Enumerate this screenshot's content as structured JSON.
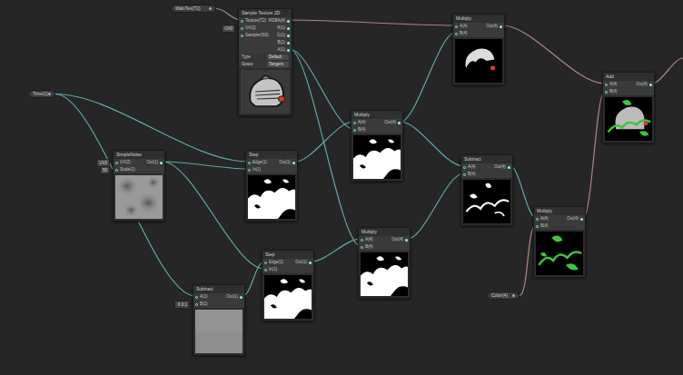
{
  "graph": {
    "nodes": [
      {
        "title": "MainTex(T2)",
        "kind": "property",
        "inputs": [],
        "outputs": [],
        "settings": []
      },
      {
        "title": "Sample Texture 2D",
        "kind": "texture",
        "inputs": [
          {
            "label": "Texture(T2)",
            "value": ""
          },
          {
            "label": "UV(2)",
            "value": "UV0"
          },
          {
            "label": "Sampler(SS)",
            "value": ""
          }
        ],
        "outputs": [
          "RGBA(4)",
          "R(1)",
          "G(1)",
          "B(1)",
          "A(1)"
        ],
        "settings": [
          {
            "label": "Type",
            "value": "Default"
          },
          {
            "label": "Space",
            "value": "Tangent"
          }
        ]
      },
      {
        "title": "Time(1)",
        "kind": "property",
        "inputs": [],
        "outputs": [],
        "settings": []
      },
      {
        "title": "SimpleNoise",
        "kind": "noise",
        "inputs": [
          {
            "label": "UV(2)",
            "value": "UV0"
          },
          {
            "label": "Scale(1)",
            "value": "50"
          }
        ],
        "outputs": [
          "Out(1)"
        ],
        "settings": []
      },
      {
        "title": "Step",
        "kind": "mask",
        "inputs": [
          {
            "label": "Edge(1)",
            "value": ""
          },
          {
            "label": "In(1)",
            "value": ""
          }
        ],
        "outputs": [
          "Out(1)"
        ],
        "settings": []
      },
      {
        "title": "Step",
        "kind": "mask",
        "inputs": [
          {
            "label": "Edge(1)",
            "value": ""
          },
          {
            "label": "In(1)",
            "value": ""
          }
        ],
        "outputs": [
          "Out(1)"
        ],
        "settings": []
      },
      {
        "title": "Subtract",
        "kind": "gradient",
        "inputs": [
          {
            "label": "A(1)",
            "value": ""
          },
          {
            "label": "B(1)",
            "value": "X 0.1"
          }
        ],
        "outputs": [
          "Out(1)"
        ],
        "settings": []
      },
      {
        "title": "Multiply",
        "kind": "mask",
        "inputs": [
          {
            "label": "A(4)",
            "value": ""
          },
          {
            "label": "B(4)",
            "value": ""
          }
        ],
        "outputs": [
          "Out(4)"
        ],
        "settings": []
      },
      {
        "title": "Multiply",
        "kind": "mask",
        "inputs": [
          {
            "label": "A(4)",
            "value": ""
          },
          {
            "label": "B(4)",
            "value": ""
          }
        ],
        "outputs": [
          "Out(4)"
        ],
        "settings": []
      },
      {
        "title": "Multiply",
        "kind": "masked",
        "inputs": [
          {
            "label": "A(4)",
            "value": ""
          },
          {
            "label": "B(4)",
            "value": ""
          }
        ],
        "outputs": [
          "Out(4)"
        ],
        "settings": []
      },
      {
        "title": "Subtract",
        "kind": "edge",
        "inputs": [
          {
            "label": "A(4)",
            "value": ""
          },
          {
            "label": "B(4)",
            "value": ""
          }
        ],
        "outputs": [
          "Out(4)"
        ],
        "settings": []
      },
      {
        "title": "Multiply",
        "kind": "tint",
        "inputs": [
          {
            "label": "A(4)",
            "value": ""
          },
          {
            "label": "B(4)",
            "value": ""
          }
        ],
        "outputs": [
          "Out(4)"
        ],
        "settings": []
      },
      {
        "title": "Add",
        "kind": "composite",
        "inputs": [
          {
            "label": "A(4)",
            "value": ""
          },
          {
            "label": "B(4)",
            "value": ""
          }
        ],
        "outputs": [
          "Out(4)"
        ],
        "settings": []
      },
      {
        "title": "Color(4)",
        "kind": "property",
        "inputs": [],
        "outputs": [],
        "settings": []
      }
    ],
    "edges": [
      {
        "from": [
          0,
          0
        ],
        "to": [
          1,
          0
        ],
        "color": "#c4959b"
      },
      {
        "from": [
          1,
          0
        ],
        "to": [
          9,
          0
        ],
        "color": "#c4959b"
      },
      {
        "from": [
          1,
          4
        ],
        "to": [
          7,
          1
        ],
        "color": "#6bbcbf"
      },
      {
        "from": [
          1,
          4
        ],
        "to": [
          8,
          1
        ],
        "color": "#6bbcbf"
      },
      {
        "from": [
          2,
          0
        ],
        "to": [
          4,
          0
        ],
        "color": "#6bbcbf"
      },
      {
        "from": [
          2,
          0
        ],
        "to": [
          6,
          0
        ],
        "color": "#6bbcbf"
      },
      {
        "from": [
          3,
          0
        ],
        "to": [
          4,
          1
        ],
        "color": "#6bbcbf"
      },
      {
        "from": [
          3,
          0
        ],
        "to": [
          5,
          1
        ],
        "color": "#6bbcbf"
      },
      {
        "from": [
          6,
          0
        ],
        "to": [
          5,
          0
        ],
        "color": "#6bbcbf"
      },
      {
        "from": [
          4,
          0
        ],
        "to": [
          7,
          0
        ],
        "color": "#6bbcbf"
      },
      {
        "from": [
          5,
          0
        ],
        "to": [
          8,
          0
        ],
        "color": "#6bbcbf"
      },
      {
        "from": [
          7,
          0
        ],
        "to": [
          9,
          1
        ],
        "color": "#6bbcbf"
      },
      {
        "from": [
          7,
          0
        ],
        "to": [
          10,
          0
        ],
        "color": "#6bbcbf"
      },
      {
        "from": [
          8,
          0
        ],
        "to": [
          10,
          1
        ],
        "color": "#6bbcbf"
      },
      {
        "from": [
          10,
          0
        ],
        "to": [
          11,
          0
        ],
        "color": "#6bbcbf"
      },
      {
        "from": [
          13,
          0
        ],
        "to": [
          11,
          1
        ],
        "color": "#c4959b"
      },
      {
        "from": [
          9,
          0
        ],
        "to": [
          12,
          0
        ],
        "color": "#c4959b"
      },
      {
        "from": [
          11,
          0
        ],
        "to": [
          12,
          1
        ],
        "color": "#c4959b"
      },
      {
        "from": [
          12,
          0
        ],
        "to": null,
        "color": "#c4959b"
      }
    ]
  }
}
